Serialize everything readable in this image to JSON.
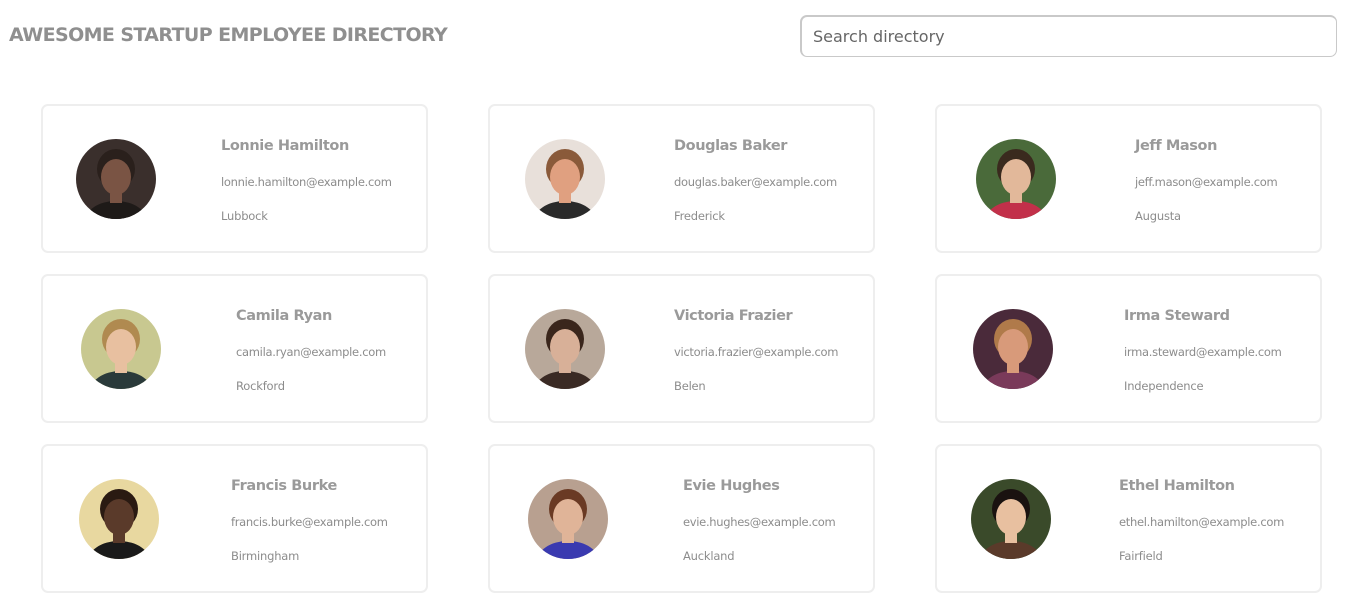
{
  "header": {
    "title": "AWESOME STARTUP EMPLOYEE DIRECTORY"
  },
  "search": {
    "placeholder": "Search directory"
  },
  "employees": [
    {
      "name": "Lonnie Hamilton",
      "email": "lonnie.hamilton@example.com",
      "city": "Lubbock",
      "avatar_bg": "#3a2f2c",
      "avatar_skin": "#7a5444",
      "avatar_hair": "#2a201c",
      "avatar_shirt": "#1e1a18"
    },
    {
      "name": "Douglas Baker",
      "email": "douglas.baker@example.com",
      "city": "Frederick",
      "avatar_bg": "#e8e0da",
      "avatar_skin": "#e0a080",
      "avatar_hair": "#8a5a3a",
      "avatar_shirt": "#2a2a2a"
    },
    {
      "name": "Jeff Mason",
      "email": "jeff.mason@example.com",
      "city": "Augusta",
      "avatar_bg": "#4a6a3a",
      "avatar_skin": "#e2b89a",
      "avatar_hair": "#3a2a1e",
      "avatar_shirt": "#c2304a"
    },
    {
      "name": "Camila Ryan",
      "email": "camila.ryan@example.com",
      "city": "Rockford",
      "avatar_bg": "#c8c890",
      "avatar_skin": "#e8c0a0",
      "avatar_hair": "#b08a50",
      "avatar_shirt": "#2a3a3a"
    },
    {
      "name": "Victoria Frazier",
      "email": "victoria.frazier@example.com",
      "city": "Belen",
      "avatar_bg": "#b8a89a",
      "avatar_skin": "#d8b098",
      "avatar_hair": "#3a261c",
      "avatar_shirt": "#3a2a24"
    },
    {
      "name": "Irma Steward",
      "email": "irma.steward@example.com",
      "city": "Independence",
      "avatar_bg": "#4a2a3a",
      "avatar_skin": "#d89a7a",
      "avatar_hair": "#b07a4a",
      "avatar_shirt": "#7a3a5a"
    },
    {
      "name": "Francis Burke",
      "email": "francis.burke@example.com",
      "city": "Birmingham",
      "avatar_bg": "#e8d8a0",
      "avatar_skin": "#5a3a2a",
      "avatar_hair": "#2a1a12",
      "avatar_shirt": "#1a1a1a"
    },
    {
      "name": "Evie Hughes",
      "email": "evie.hughes@example.com",
      "city": "Auckland",
      "avatar_bg": "#b8a090",
      "avatar_skin": "#e0b498",
      "avatar_hair": "#6a3a24",
      "avatar_shirt": "#3a3ab0"
    },
    {
      "name": "Ethel Hamilton",
      "email": "ethel.hamilton@example.com",
      "city": "Fairfield",
      "avatar_bg": "#3a4a2a",
      "avatar_skin": "#e8c0a0",
      "avatar_hair": "#1a1210",
      "avatar_shirt": "#5a3a2a"
    }
  ]
}
